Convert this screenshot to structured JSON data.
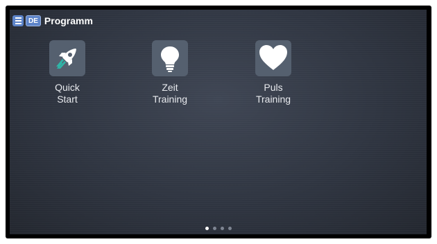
{
  "header": {
    "title": "Programm",
    "language": "DE",
    "menu_icon": "hamburger-menu-icon"
  },
  "tiles": [
    {
      "label_line1": "Quick",
      "label_line2": "Start",
      "icon": "rocket-icon"
    },
    {
      "label_line1": "Zeit",
      "label_line2": "Training",
      "icon": "lightbulb-icon"
    },
    {
      "label_line1": "Puls",
      "label_line2": "Training",
      "icon": "heart-icon"
    }
  ],
  "pager": {
    "page_count": 4,
    "current_page": 1
  },
  "colors": {
    "accent": "#5d84c9",
    "tile_background": "#55606f",
    "screen_background": "#2f3541",
    "rocket_flame": "#2fb6a8"
  }
}
